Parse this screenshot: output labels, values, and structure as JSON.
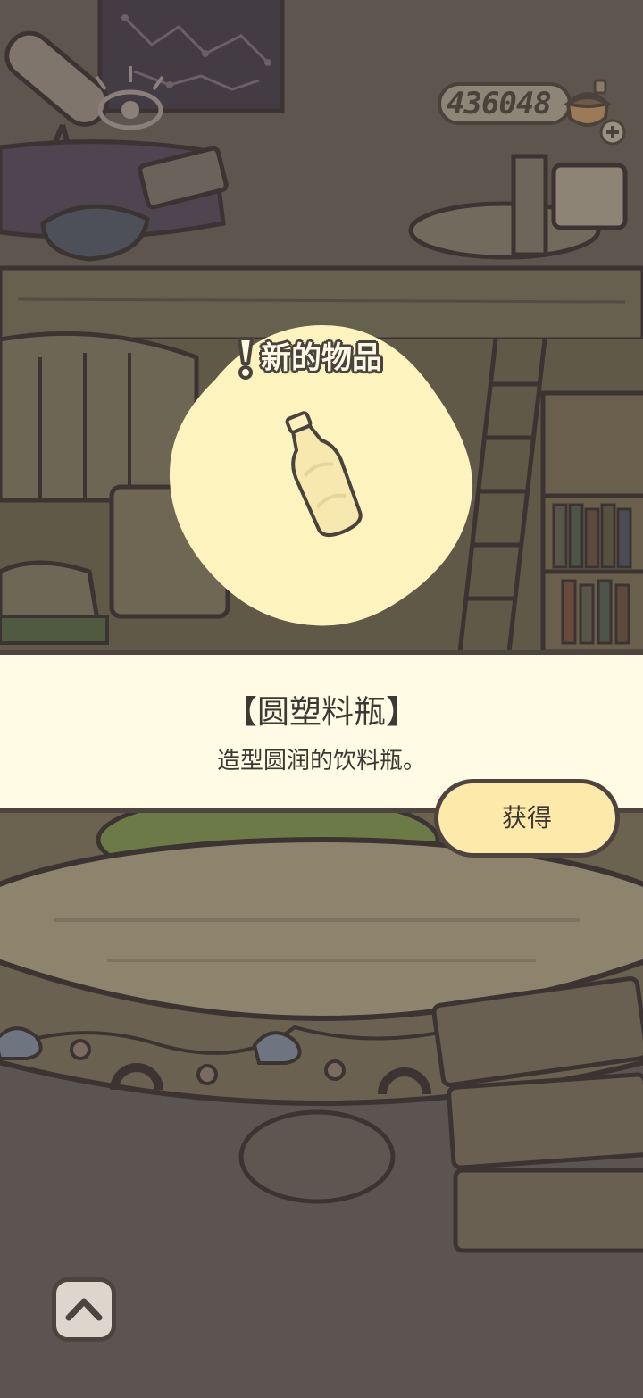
{
  "currency": {
    "amount": "436048",
    "coin_icon": "acorn-coin-icon",
    "add_icon": "plus-icon"
  },
  "popup": {
    "badge": "新的物品",
    "item_icon": "plastic-bottle-icon",
    "item_name": "【圆塑料瓶】",
    "item_description": "造型圆润的饮料瓶。",
    "obtain_label": "获得"
  },
  "toolbar": {
    "collapse_icon": "chevron-up-icon"
  },
  "colors": {
    "background": "#5c5450",
    "panel": "#fffbe4",
    "glow": "#fdf3bf",
    "button": "#fde9a9",
    "outline": "#4d4440"
  }
}
